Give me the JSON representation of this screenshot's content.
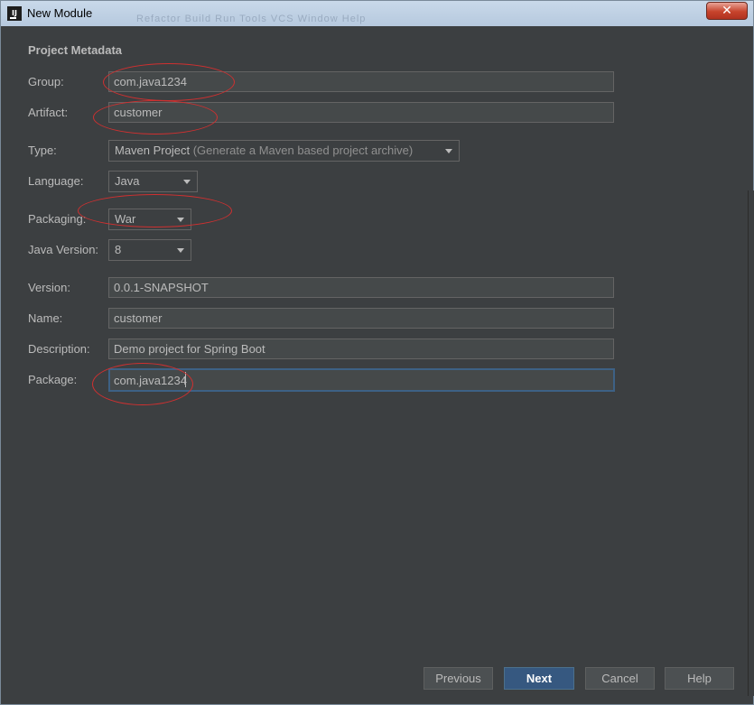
{
  "window": {
    "title": "New Module",
    "close_label": "✕",
    "app_icon_glyph": "IJ",
    "background_menu": "Refactor  Build  Run  Tools  VCS  Window  Help"
  },
  "section": {
    "title": "Project Metadata"
  },
  "form": {
    "group": {
      "label": "Group:",
      "value": "com.java1234"
    },
    "artifact": {
      "label": "Artifact:",
      "value": "customer"
    },
    "type": {
      "label": "Type:",
      "value": "Maven Project",
      "hint": "(Generate a Maven based project archive)"
    },
    "language": {
      "label": "Language:",
      "value": "Java"
    },
    "packaging": {
      "label": "Packaging:",
      "value": "War"
    },
    "java_version": {
      "label": "Java Version:",
      "value": "8"
    },
    "version": {
      "label": "Version:",
      "value": "0.0.1-SNAPSHOT"
    },
    "name": {
      "label": "Name:",
      "value": "customer"
    },
    "description": {
      "label": "Description:",
      "value": "Demo project for Spring Boot"
    },
    "package": {
      "label": "Package:",
      "value": "com.java1234"
    }
  },
  "buttons": {
    "previous": "Previous",
    "next": "Next",
    "cancel": "Cancel",
    "help": "Help"
  },
  "colors": {
    "background": "#3c3f41",
    "field_bg": "#45494a",
    "text": "#bbbbbb",
    "annotation": "#d03030",
    "default_button": "#365880",
    "focus_border": "#3d6185"
  }
}
